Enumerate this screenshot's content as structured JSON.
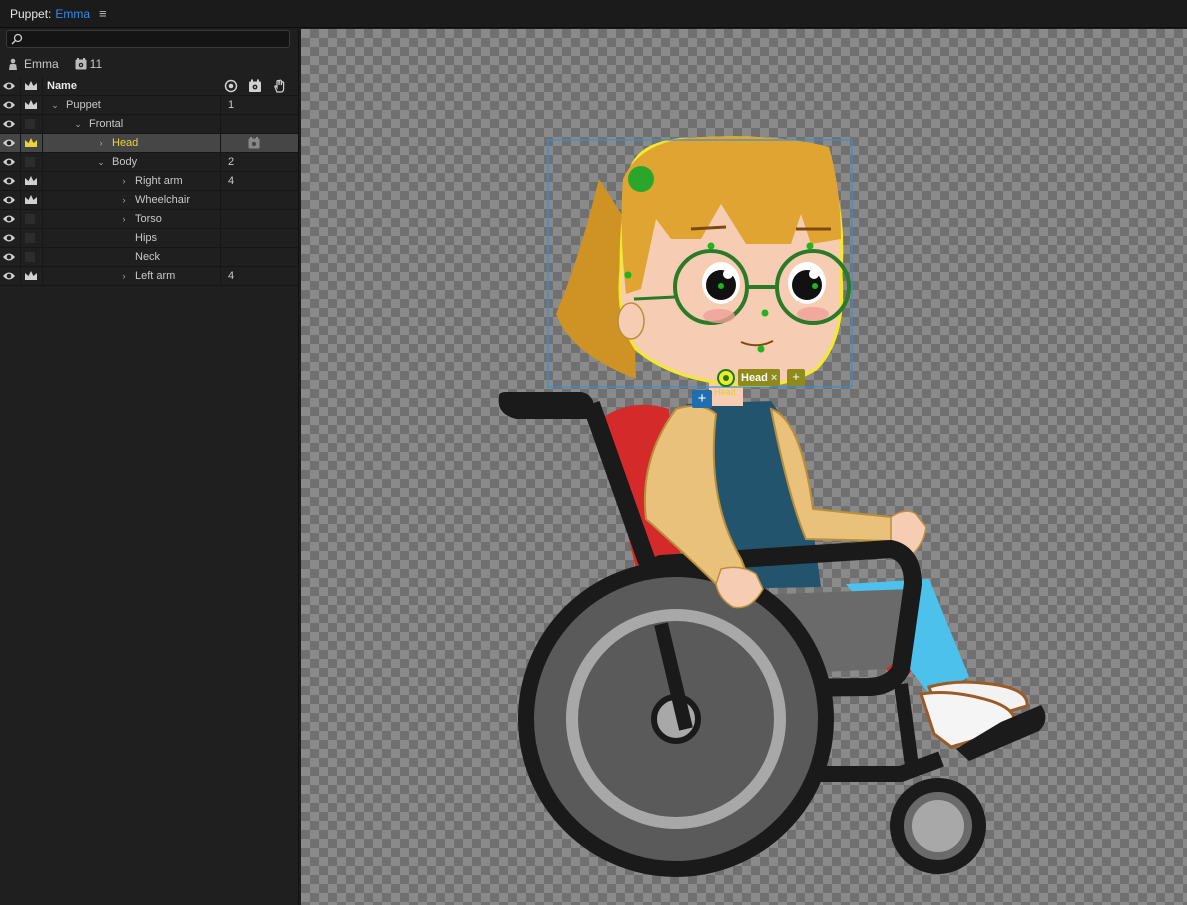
{
  "titlebar": {
    "label": "Puppet:",
    "puppet_name": "Emma",
    "menu_icon": "hamburger-menu-icon"
  },
  "search": {
    "value": "",
    "placeholder": ""
  },
  "info": {
    "puppet_name": "Emma",
    "trigger_count": "11"
  },
  "table": {
    "header": {
      "name": "Name"
    },
    "rows": [
      {
        "name": "Puppet",
        "count": "1",
        "crown": true,
        "expander": "expanded",
        "indent": 0,
        "selected": false,
        "tagged": false
      },
      {
        "name": "Frontal",
        "count": "",
        "crown": false,
        "expander": "expanded",
        "indent": 1,
        "selected": false,
        "tagged": false
      },
      {
        "name": "Head",
        "count": "",
        "crown": true,
        "expander": "collapsed",
        "indent": 2,
        "selected": true,
        "tagged": true
      },
      {
        "name": "Body",
        "count": "2",
        "crown": false,
        "expander": "expanded",
        "indent": 2,
        "selected": false,
        "tagged": false
      },
      {
        "name": "Right arm",
        "count": "4",
        "crown": true,
        "expander": "collapsed",
        "indent": 3,
        "selected": false,
        "tagged": false
      },
      {
        "name": "Wheelchair",
        "count": "",
        "crown": true,
        "expander": "collapsed",
        "indent": 3,
        "selected": false,
        "tagged": false
      },
      {
        "name": "Torso",
        "count": "",
        "crown": false,
        "expander": "collapsed",
        "indent": 3,
        "selected": false,
        "tagged": false
      },
      {
        "name": "Hips",
        "count": "",
        "crown": false,
        "expander": "none",
        "indent": 3,
        "selected": false,
        "tagged": false
      },
      {
        "name": "Neck",
        "count": "",
        "crown": false,
        "expander": "none",
        "indent": 3,
        "selected": false,
        "tagged": false
      },
      {
        "name": "Left arm",
        "count": "4",
        "crown": true,
        "expander": "collapsed",
        "indent": 3,
        "selected": false,
        "tagged": false
      }
    ]
  },
  "canvas": {
    "handle_tag": {
      "label": "Head",
      "close": "×",
      "add": "+"
    },
    "handle_sublabel": "Head",
    "add_handle": "+"
  },
  "colors": {
    "accent_blue": "#2d8ceb",
    "selected_text": "#e9d43a",
    "selection_outline": "#f2ea2a",
    "bounding_box": "#3a8fd0",
    "handle_green": "#1db41d"
  }
}
